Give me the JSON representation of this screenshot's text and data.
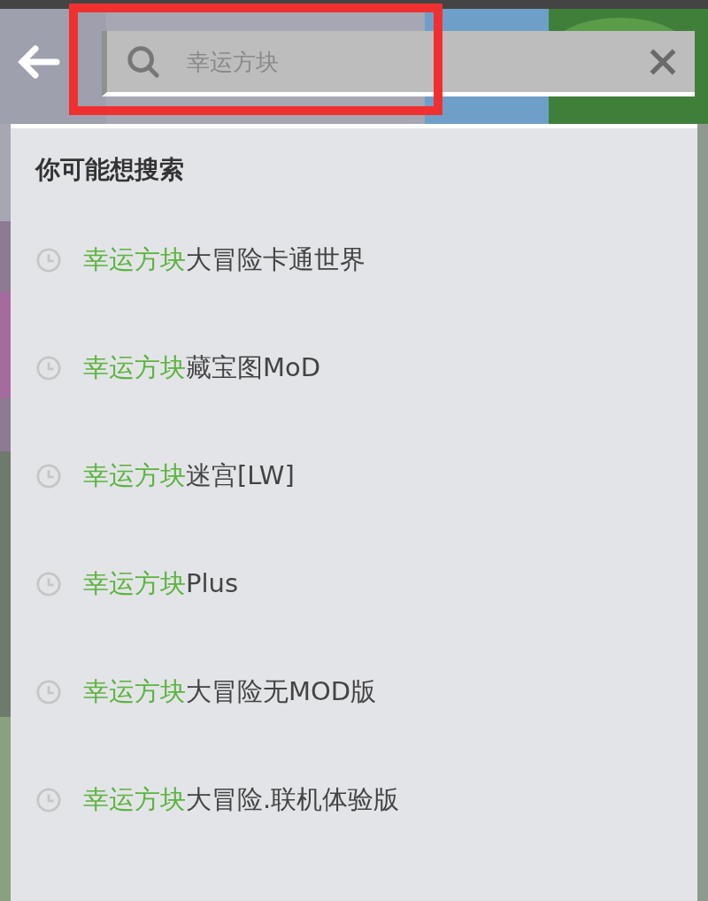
{
  "search": {
    "placeholder": "幸运方块",
    "highlighted": true
  },
  "suggestions": {
    "title": "你可能想搜索",
    "items": [
      {
        "match": "幸运方块",
        "rest": "大冒险卡通世界"
      },
      {
        "match": "幸运方块",
        "rest": "藏宝图MoD"
      },
      {
        "match": "幸运方块",
        "rest": "迷宫[LW]"
      },
      {
        "match": "幸运方块",
        "rest": "Plus"
      },
      {
        "match": "幸运方块",
        "rest": "大冒险无MOD版"
      },
      {
        "match": "幸运方块",
        "rest": "大冒险.联机体验版"
      }
    ]
  }
}
